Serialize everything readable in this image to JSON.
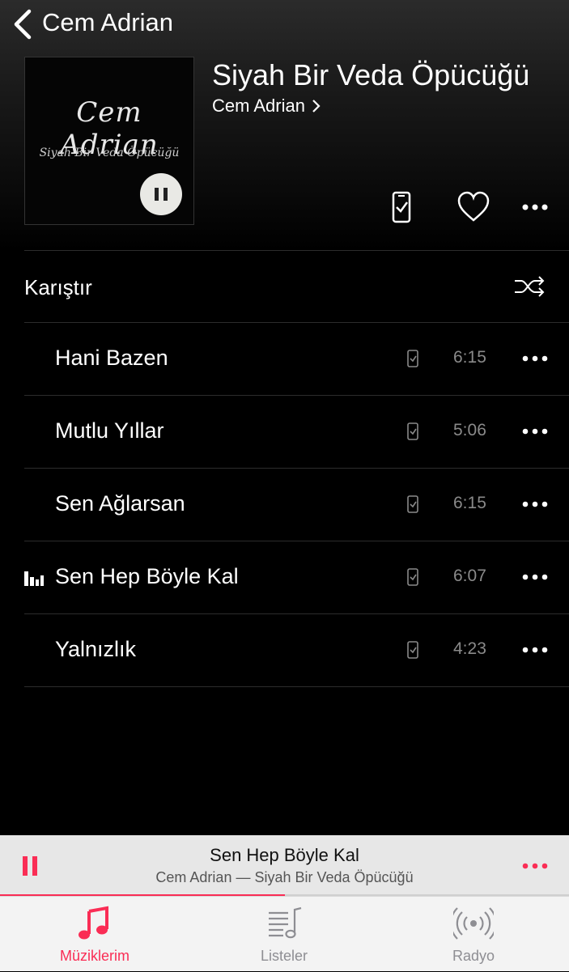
{
  "nav": {
    "back_title": "Cem Adrian"
  },
  "album": {
    "title": "Siyah Bir Veda Öpücüğü",
    "artist": "Cem Adrian",
    "artwork_text_line1": "Cem Adrian",
    "artwork_text_line2": "Siyah Bir Veda Öpücüğü"
  },
  "actions": {
    "icons": [
      "device-downloaded-icon",
      "heart-icon",
      "more-icon"
    ]
  },
  "shuffle": {
    "label": "Karıştır",
    "icon": "shuffle-icon"
  },
  "tracks": [
    {
      "name": "Hani Bazen",
      "duration": "6:15",
      "playing": false
    },
    {
      "name": "Mutlu Yıllar",
      "duration": "5:06",
      "playing": false
    },
    {
      "name": "Sen Ağlarsan",
      "duration": "6:15",
      "playing": false
    },
    {
      "name": "Sen Hep Böyle Kal",
      "duration": "6:07",
      "playing": true
    },
    {
      "name": "Yalnızlık",
      "duration": "4:23",
      "playing": false
    }
  ],
  "mini_player": {
    "title": "Sen Hep Böyle Kal",
    "subtitle": "Cem Adrian — Siyah Bir Veda Öpücüğü",
    "progress": 0.5
  },
  "tabs": [
    {
      "label": "Müziklerim",
      "icon": "music-note-icon",
      "active": true
    },
    {
      "label": "Listeler",
      "icon": "playlist-icon",
      "active": false
    },
    {
      "label": "Radyo",
      "icon": "radio-icon",
      "active": false
    }
  ],
  "colors": {
    "accent": "#fa2d55",
    "inactive_tab": "#8e8e93",
    "duration_gray": "#8a8a8a"
  }
}
